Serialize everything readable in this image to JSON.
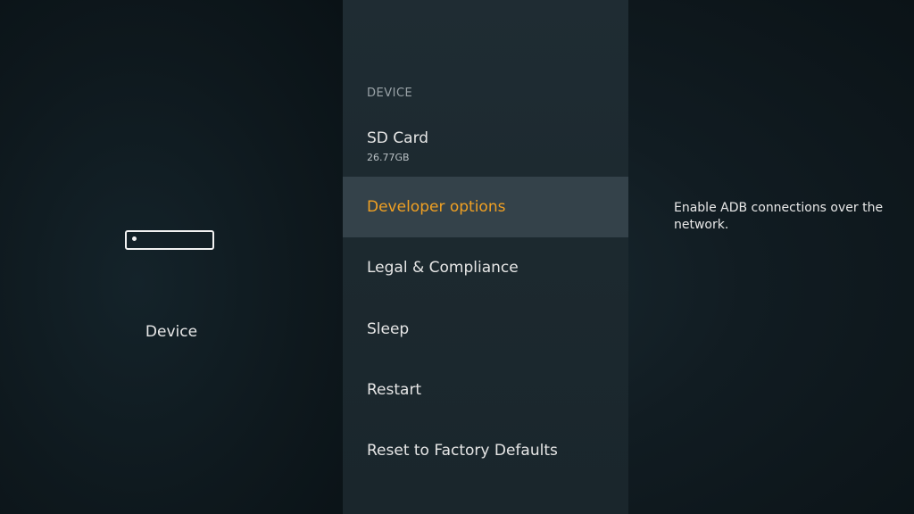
{
  "left_panel": {
    "icon": "fire-tv-device-icon",
    "label": "Device"
  },
  "menu": {
    "section_header": "DEVICE",
    "items": [
      {
        "label": "SD Card",
        "sub": "26.77GB"
      },
      {
        "label": "Developer options",
        "selected": true
      },
      {
        "label": "Legal & Compliance"
      },
      {
        "label": "Sleep"
      },
      {
        "label": "Restart"
      },
      {
        "label": "Reset to Factory Defaults"
      }
    ]
  },
  "detail": {
    "description": "Enable ADB connections over the network."
  },
  "colors": {
    "accent": "#f0a023",
    "selected_bg": "#34424a",
    "menu_bg": "#1e2b31",
    "background": "#0e181d"
  }
}
